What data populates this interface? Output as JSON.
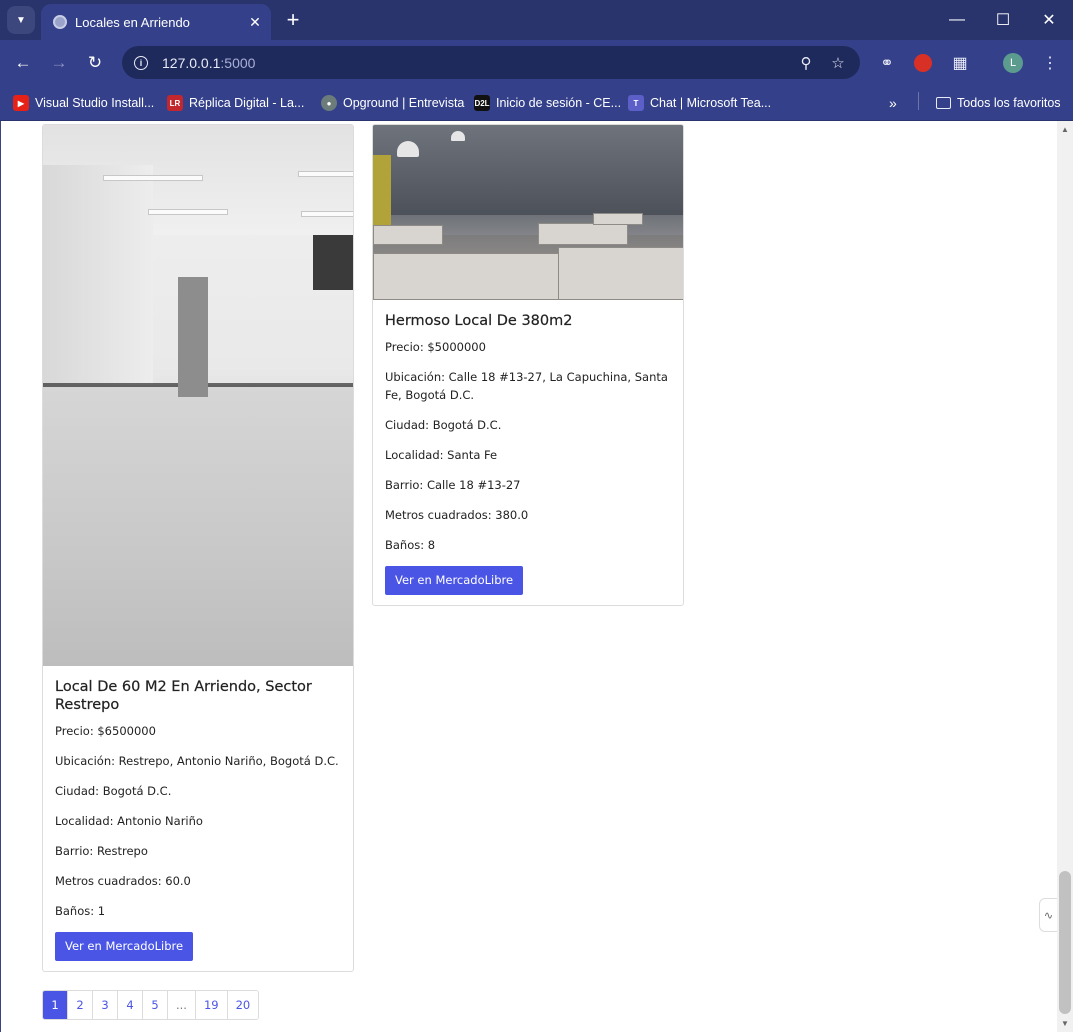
{
  "browser": {
    "tab_title": "Locales en Arriendo",
    "url_host": "127.0.0.1",
    "url_port": ":5000",
    "bookmarks": [
      {
        "label": "Visual Studio Install...",
        "icon": "youtube-icon",
        "color": "#e62117"
      },
      {
        "label": "Réplica Digital - La...",
        "icon": "lr-icon",
        "color": "#c1272d"
      },
      {
        "label": "Opground | Entrevista",
        "icon": "opground-icon",
        "color": "#6b7c7a"
      },
      {
        "label": "Inicio de sesión - CE...",
        "icon": "d2l-icon",
        "color": "#111111"
      },
      {
        "label": "Chat | Microsoft Tea...",
        "icon": "teams-icon",
        "color": "#5b5fc7"
      }
    ],
    "all_bookmarks": "Todos los favoritos",
    "profile_initial": "L"
  },
  "listings": [
    {
      "title": "Local De 60 M2 En Arriendo, Sector Restrepo",
      "precio": "Precio: $6500000",
      "ubicacion": "Ubicación: Restrepo, Antonio Nariño, Bogotá D.C.",
      "ciudad": "Ciudad: Bogotá D.C.",
      "localidad": "Localidad: Antonio Nariño",
      "barrio": "Barrio: Restrepo",
      "metros": "Metros cuadrados: 60.0",
      "banos": "Baños: 1",
      "button": "Ver en MercadoLibre"
    },
    {
      "title": "Hermoso Local De 380m2",
      "precio": "Precio: $5000000",
      "ubicacion": "Ubicación: Calle 18 #13-27, La Capuchina, Santa Fe, Bogotá D.C.",
      "ciudad": "Ciudad: Bogotá D.C.",
      "localidad": "Localidad: Santa Fe",
      "barrio": "Barrio: Calle 18 #13-27",
      "metros": "Metros cuadrados: 380.0",
      "banos": "Baños: 8",
      "button": "Ver en MercadoLibre"
    }
  ],
  "pagination": {
    "pages": [
      "1",
      "2",
      "3",
      "4",
      "5",
      "...",
      "19",
      "20"
    ],
    "active": "1"
  },
  "colors": {
    "accent": "#4a55e6",
    "chrome_frame": "#28346b",
    "chrome_toolbar": "#34418a"
  }
}
